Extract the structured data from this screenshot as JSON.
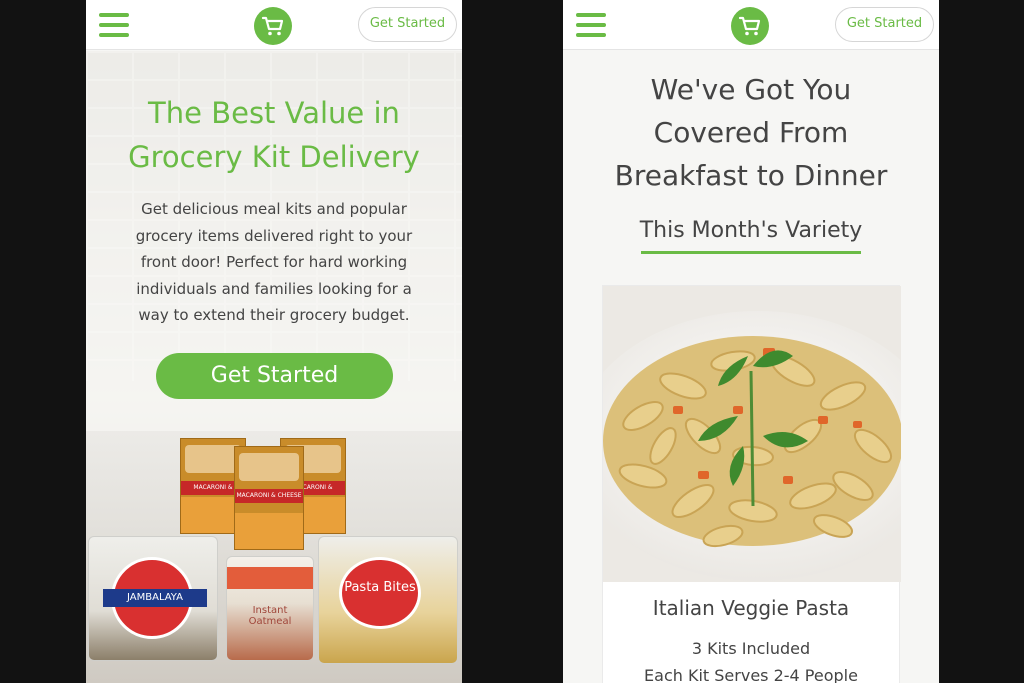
{
  "brand": {
    "accent": "#6abb45",
    "text": "#444444",
    "background": "#121212"
  },
  "left_screen": {
    "nav": {
      "menu_icon": "hamburger-icon",
      "logo_icon": "shopping-cart-icon",
      "cta_label": "Get Started"
    },
    "hero": {
      "title_line1": "The Best Value in",
      "title_line2": "Grocery Kit Delivery",
      "body_lines": [
        "Get delicious meal kits and popular",
        "grocery items delivered right to your",
        "front door! Perfect for hard working",
        "individuals and families looking for a",
        "way to extend their grocery budget."
      ],
      "cta_label": "Get Started"
    },
    "products": {
      "box_label": "MACARONI & CHEESE",
      "jambalaya_label": "JAMBALAYA",
      "oatmeal_label": "Instant Oatmeal",
      "pasta_label": "Pasta Bites"
    }
  },
  "right_screen": {
    "nav": {
      "menu_icon": "hamburger-icon",
      "logo_icon": "shopping-cart-icon",
      "cta_label": "Get Started"
    },
    "title_lines": [
      "We've Got You",
      "Covered From",
      "Breakfast to Dinner"
    ],
    "subtitle": "This Month's Variety",
    "card": {
      "title": "Italian Veggie Pasta",
      "kits": "3 Kits Included",
      "serves": "Each Kit Serves 2-4 People"
    }
  }
}
